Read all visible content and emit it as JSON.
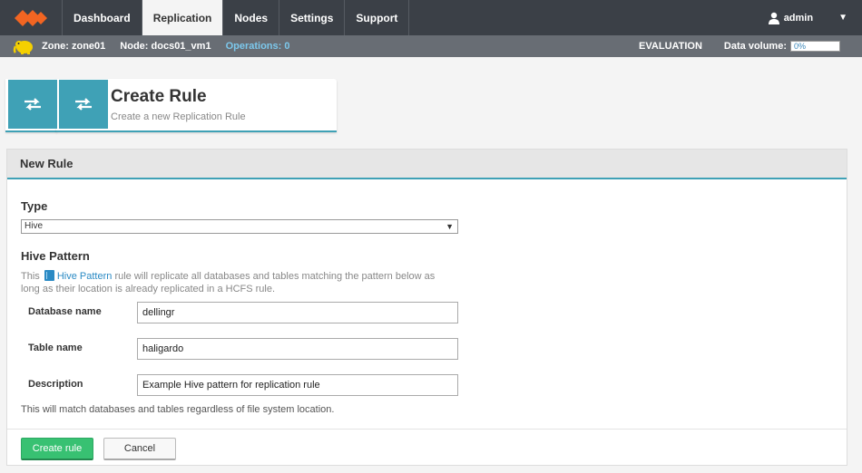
{
  "brand": {
    "logo_icon": "wandisco-logo-icon",
    "logo_color": "#f26522"
  },
  "nav": {
    "items": [
      {
        "label": "Dashboard",
        "active": false
      },
      {
        "label": "Replication",
        "active": true
      },
      {
        "label": "Nodes",
        "active": false
      },
      {
        "label": "Settings",
        "active": false
      },
      {
        "label": "Support",
        "active": false
      }
    ],
    "user": {
      "name": "admin",
      "icon": "user-icon"
    }
  },
  "status": {
    "zone": "Zone: zone01",
    "node": "Node: docs01_vm1",
    "operations": "Operations: 0",
    "evaluation": "EVALUATION",
    "data_volume_label": "Data volume:",
    "data_volume_value": "0%",
    "data_volume_fraction": 0
  },
  "header": {
    "title": "Create Rule",
    "subtitle": "Create a new Replication Rule",
    "icon": "replication-arrows-icon",
    "accent": "#3fa1b6"
  },
  "panel": {
    "title": "New Rule",
    "type_label": "Type",
    "type_value": "Hive",
    "pattern_heading": "Hive Pattern",
    "desc_pre": "This",
    "desc_link": "Hive Pattern",
    "desc_post": "rule will replicate all databases and tables matching the pattern below as long as their location is already replicated in a HCFS rule.",
    "fields": {
      "database_label": "Database name",
      "database_value": "dellingr",
      "table_label": "Table name",
      "table_value": "haligardo",
      "description_label": "Description",
      "description_value": "Example Hive pattern for replication rule"
    },
    "note": "This will match databases and tables regardless of file system location.",
    "create_label": "Create rule",
    "cancel_label": "Cancel"
  }
}
